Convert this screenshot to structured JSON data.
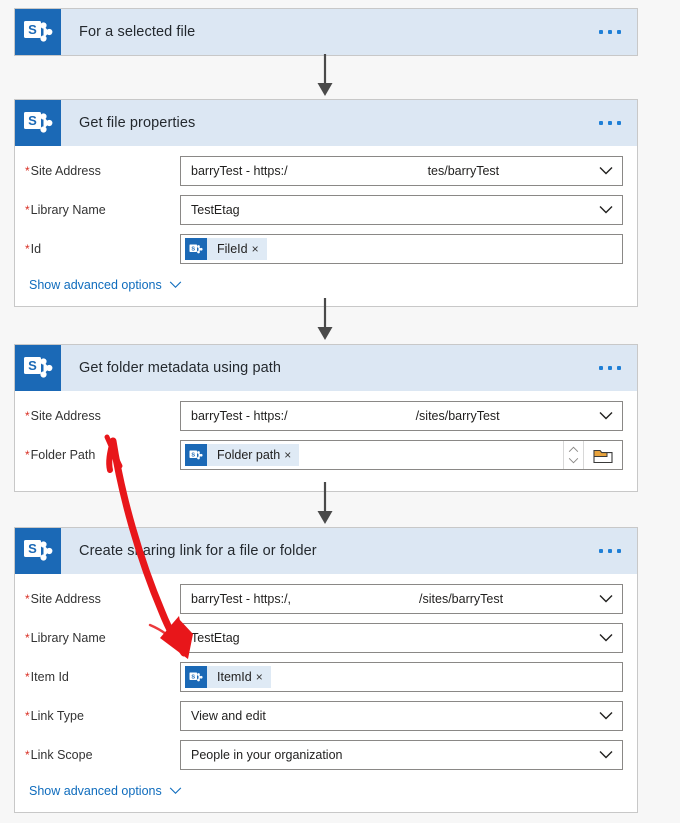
{
  "app": {
    "connector_icon": "sharepoint-icon",
    "accent_blue": "#1b69b6",
    "header_bg": "#dce7f3",
    "required_asterisk": "*",
    "ellipsis_label": "...",
    "annotation_color": "#e8161a"
  },
  "cards": [
    {
      "id": "for-a-selected-file",
      "title": "For a selected file",
      "fields": []
    },
    {
      "id": "get-file-properties",
      "title": "Get file properties",
      "advanced_label": "Show advanced options",
      "fields": [
        {
          "label": "Site Address",
          "required": true,
          "type": "dropdown",
          "value_left": "barryTest - https:/",
          "value_right": "tes/barryTest",
          "redacted": true
        },
        {
          "label": "Library Name",
          "required": true,
          "type": "dropdown",
          "value": "TestEtag"
        },
        {
          "label": "Id",
          "required": true,
          "type": "token",
          "token": "FileId",
          "token_remove": "×"
        }
      ]
    },
    {
      "id": "get-folder-metadata-using-path",
      "title": "Get folder metadata using path",
      "fields": [
        {
          "label": "Site Address",
          "required": true,
          "type": "dropdown",
          "value_left": "barryTest - https:/",
          "value_right": "/sites/barryTest",
          "redacted": true
        },
        {
          "label": "Folder Path",
          "required": true,
          "type": "token-picker",
          "token": "Folder path",
          "token_remove": "×",
          "picker_icon": "folder-icon",
          "spinner_icon": "spinner-up-down-icon"
        }
      ]
    },
    {
      "id": "create-sharing-link-for-a-file-or-folder",
      "title": "Create sharing link for a file or folder",
      "advanced_label": "Show advanced options",
      "fields": [
        {
          "label": "Site Address",
          "required": true,
          "type": "dropdown",
          "value_left": "barryTest - https:/,",
          "value_right": "/sites/barryTest",
          "redacted": true
        },
        {
          "label": "Library Name",
          "required": true,
          "type": "dropdown",
          "value": "TestEtag"
        },
        {
          "label": "Item Id",
          "required": true,
          "type": "token",
          "token": "ItemId",
          "token_remove": "×"
        },
        {
          "label": "Link Type",
          "required": true,
          "type": "dropdown",
          "value": "View and edit"
        },
        {
          "label": "Link Scope",
          "required": true,
          "type": "dropdown",
          "value": "People in your organization"
        }
      ]
    }
  ]
}
